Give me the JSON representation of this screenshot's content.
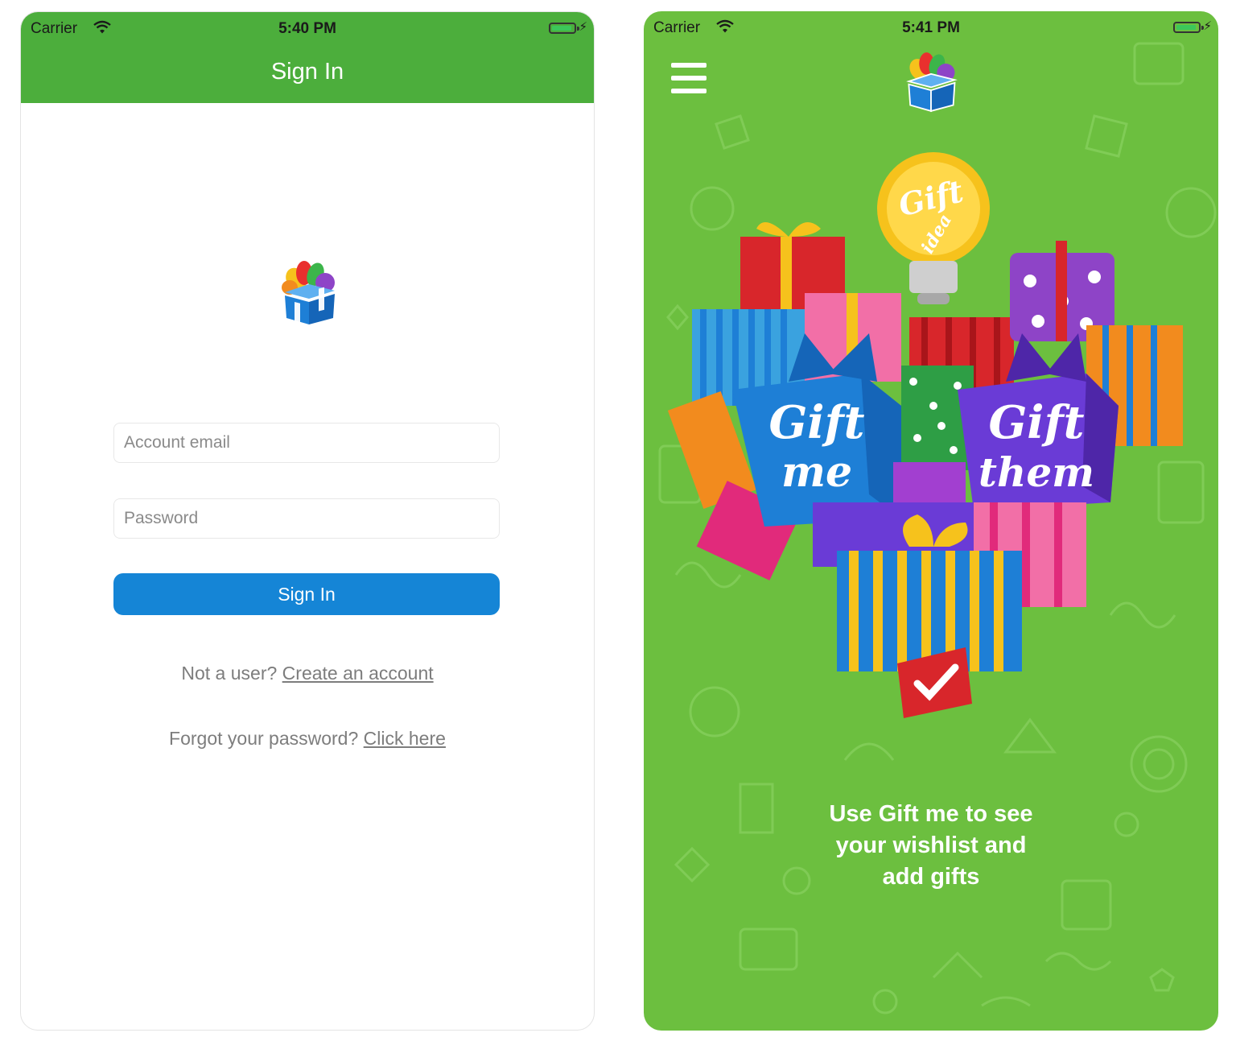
{
  "left_screen": {
    "status_bar": {
      "carrier": "Carrier",
      "time": "5:40 PM"
    },
    "nav_title": "Sign In",
    "email_placeholder": "Account email",
    "password_placeholder": "Password",
    "sign_in_button": "Sign In",
    "create_account": {
      "prompt": "Not a user?",
      "link": "Create an account"
    },
    "forgot_password": {
      "prompt": "Forgot your password?",
      "link": "Click here"
    }
  },
  "right_screen": {
    "status_bar": {
      "carrier": "Carrier",
      "time": "5:41 PM"
    },
    "hero": {
      "bulb_text": [
        "Gift",
        "idea"
      ],
      "left_box_text": [
        "Gift",
        "me"
      ],
      "right_box_text": [
        "Gift",
        "them"
      ]
    },
    "caption_lines": [
      "Use Gift me to see",
      "your wishlist and",
      "add gifts"
    ]
  },
  "colors": {
    "nav_green": "#4cae3c",
    "background_green": "#6cbf3f",
    "button_blue": "#1585d6",
    "helper_gray": "#7d7d7d"
  },
  "icons": [
    "wifi-icon",
    "battery-icon",
    "charging-bolt-icon",
    "menu-icon",
    "app-logo-icon",
    "checkmark-icon"
  ]
}
